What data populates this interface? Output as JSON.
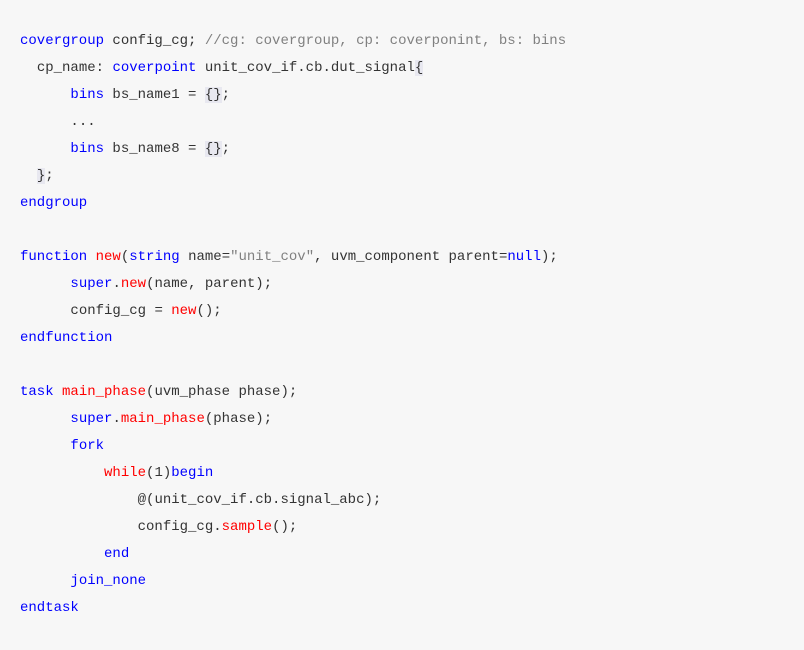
{
  "code": {
    "lines": [
      {
        "indent": 0,
        "tokens": [
          {
            "t": "covergroup",
            "c": "kw-blue"
          },
          {
            "t": " config_cg",
            "c": "ident"
          },
          {
            "t": ";",
            "c": "punct"
          },
          {
            "t": " ",
            "c": "punct"
          },
          {
            "t": "//cg: covergroup, cp: coverponint, bs: bins",
            "c": "comment-gray"
          }
        ]
      },
      {
        "indent": 1,
        "tokens": [
          {
            "t": "cp_name",
            "c": "ident"
          },
          {
            "t": ": ",
            "c": "punct"
          },
          {
            "t": "coverpoint",
            "c": "kw-blue"
          },
          {
            "t": " unit_cov_if.cb.dut_signal",
            "c": "ident"
          },
          {
            "t": "{",
            "c": "brace-highlight"
          }
        ]
      },
      {
        "indent": 3,
        "tokens": [
          {
            "t": "bins",
            "c": "kw-blue"
          },
          {
            "t": " bs_name1 ",
            "c": "ident"
          },
          {
            "t": "=",
            "c": "punct"
          },
          {
            "t": " ",
            "c": "punct"
          },
          {
            "t": "{}",
            "c": "brace-highlight"
          },
          {
            "t": ";",
            "c": "punct"
          }
        ]
      },
      {
        "indent": 3,
        "tokens": [
          {
            "t": "...",
            "c": "ident"
          }
        ]
      },
      {
        "indent": 3,
        "tokens": [
          {
            "t": "bins",
            "c": "kw-blue"
          },
          {
            "t": " bs_name8 ",
            "c": "ident"
          },
          {
            "t": "=",
            "c": "punct"
          },
          {
            "t": " ",
            "c": "punct"
          },
          {
            "t": "{}",
            "c": "brace-highlight"
          },
          {
            "t": ";",
            "c": "punct"
          }
        ]
      },
      {
        "indent": 1,
        "tokens": [
          {
            "t": "}",
            "c": "brace-highlight"
          },
          {
            "t": ";",
            "c": "punct"
          }
        ]
      },
      {
        "indent": 0,
        "tokens": [
          {
            "t": "endgroup",
            "c": "kw-blue"
          }
        ]
      },
      {
        "indent": 0,
        "tokens": []
      },
      {
        "indent": 0,
        "tokens": [
          {
            "t": "function",
            "c": "kw-blue"
          },
          {
            "t": " ",
            "c": "punct"
          },
          {
            "t": "new",
            "c": "kw-red"
          },
          {
            "t": "(",
            "c": "punct"
          },
          {
            "t": "string",
            "c": "kw-blue"
          },
          {
            "t": " name",
            "c": "ident"
          },
          {
            "t": "=",
            "c": "punct"
          },
          {
            "t": "\"unit_cov\"",
            "c": "str-gray"
          },
          {
            "t": ", uvm_component parent",
            "c": "ident"
          },
          {
            "t": "=",
            "c": "punct"
          },
          {
            "t": "null",
            "c": "kw-blue"
          },
          {
            "t": ")",
            "c": "punct"
          },
          {
            "t": ";",
            "c": "punct"
          }
        ]
      },
      {
        "indent": 3,
        "tokens": [
          {
            "t": "super",
            "c": "kw-blue"
          },
          {
            "t": ".",
            "c": "punct"
          },
          {
            "t": "new",
            "c": "kw-red"
          },
          {
            "t": "(",
            "c": "punct"
          },
          {
            "t": "name, parent",
            "c": "ident"
          },
          {
            "t": ")",
            "c": "punct"
          },
          {
            "t": ";",
            "c": "punct"
          }
        ]
      },
      {
        "indent": 3,
        "tokens": [
          {
            "t": "config_cg ",
            "c": "ident"
          },
          {
            "t": "=",
            "c": "punct"
          },
          {
            "t": " ",
            "c": "punct"
          },
          {
            "t": "new",
            "c": "kw-red"
          },
          {
            "t": "()",
            "c": "punct"
          },
          {
            "t": ";",
            "c": "punct"
          }
        ]
      },
      {
        "indent": 0,
        "tokens": [
          {
            "t": "endfunction",
            "c": "kw-blue"
          }
        ]
      },
      {
        "indent": 0,
        "tokens": []
      },
      {
        "indent": 0,
        "tokens": [
          {
            "t": "task",
            "c": "kw-blue"
          },
          {
            "t": " ",
            "c": "punct"
          },
          {
            "t": "main_phase",
            "c": "kw-red"
          },
          {
            "t": "(",
            "c": "punct"
          },
          {
            "t": "uvm_phase phase",
            "c": "ident"
          },
          {
            "t": ")",
            "c": "punct"
          },
          {
            "t": ";",
            "c": "punct"
          }
        ]
      },
      {
        "indent": 3,
        "tokens": [
          {
            "t": "super",
            "c": "kw-blue"
          },
          {
            "t": ".",
            "c": "punct"
          },
          {
            "t": "main_phase",
            "c": "kw-red"
          },
          {
            "t": "(",
            "c": "punct"
          },
          {
            "t": "phase",
            "c": "ident"
          },
          {
            "t": ")",
            "c": "punct"
          },
          {
            "t": ";",
            "c": "punct"
          }
        ]
      },
      {
        "indent": 3,
        "tokens": [
          {
            "t": "fork",
            "c": "kw-blue"
          }
        ]
      },
      {
        "indent": 5,
        "tokens": [
          {
            "t": "while",
            "c": "kw-red"
          },
          {
            "t": "(",
            "c": "punct"
          },
          {
            "t": "1",
            "c": "num-lit"
          },
          {
            "t": ")",
            "c": "punct"
          },
          {
            "t": "begin",
            "c": "kw-blue"
          }
        ]
      },
      {
        "indent": 7,
        "tokens": [
          {
            "t": "@",
            "c": "punct"
          },
          {
            "t": "(",
            "c": "punct"
          },
          {
            "t": "unit_cov_if.cb.signal_abc",
            "c": "ident"
          },
          {
            "t": ")",
            "c": "punct"
          },
          {
            "t": ";",
            "c": "punct"
          }
        ]
      },
      {
        "indent": 7,
        "tokens": [
          {
            "t": "config_cg.",
            "c": "ident"
          },
          {
            "t": "sample",
            "c": "kw-red"
          },
          {
            "t": "()",
            "c": "punct"
          },
          {
            "t": ";",
            "c": "punct"
          }
        ]
      },
      {
        "indent": 5,
        "tokens": [
          {
            "t": "end",
            "c": "kw-blue"
          }
        ]
      },
      {
        "indent": 3,
        "tokens": [
          {
            "t": "join_none",
            "c": "kw-blue"
          }
        ]
      },
      {
        "indent": 0,
        "tokens": [
          {
            "t": "endtask",
            "c": "kw-blue"
          }
        ]
      }
    ]
  }
}
